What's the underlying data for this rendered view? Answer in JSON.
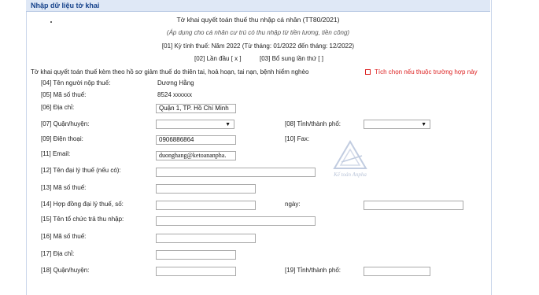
{
  "panel": {
    "title": "Nhập dữ liệu tờ khai"
  },
  "form": {
    "title": "Tờ khai quyết toán thuế thu nhập cá nhân (TT80/2021)",
    "subtitle": "(Áp dụng cho cá nhân cư trú có thu nhập từ tiền lương, tiền công)",
    "period": "[01] Kỳ tính thuế:   Năm 2022 (Từ tháng: 01/2022 đến tháng: 12/2022)",
    "first_time": "[02] Lần đầu [ x ]",
    "supplement": "[03] Bổ sung lần thứ   [ ]",
    "note": "Tờ khai quyết toán thuế kèm theo hồ sơ giảm thuế do thiên tai, hoả hoạn, tai nạn, bệnh hiểm nghèo",
    "checkbox_label": "Tích chọn nếu thuộc trường hợp này",
    "checkbox_checked": false
  },
  "fields": {
    "f04_label": "[04] Tên người nộp thuế:",
    "f04_value": "Dương Hằng",
    "f05_label": "[05] Mã số thuế:",
    "f05_value": "8524 xxxxxx",
    "f06_label": "[06] Địa chỉ:",
    "f06_value": "Quận 1, TP. Hồ Chí Minh",
    "f07_label": "[07] Quận/huyện:",
    "f08_label": "[08] Tỉnh/thành phố:",
    "f09_label": "[09] Điện thoại:",
    "f09_value": "0906886864",
    "f10_label": "[10] Fax:",
    "f11_label": "[11] Email:",
    "f11_value": "duonghang@ketoananpha.",
    "f12_label": "[12] Tên đại lý thuế (nếu có):",
    "f13_label": "[13] Mã số thuế:",
    "f14_label": "[14] Hợp đồng đại lý thuế, số:",
    "f14_date_label": "ngày:",
    "f15_label": "[15] Tên tổ chức trả thu nhập:",
    "f16_label": "[16] Mã số thuế:",
    "f17_label": "[17] Địa chỉ:",
    "f18_label": "[18] Quận/huyện:",
    "f19_label": "[19] Tỉnh/thành phố:"
  },
  "watermark": {
    "text": "Kế toán Anpha",
    "color": "#7f93b8"
  },
  "colors": {
    "header_bg": "#dfe8f6",
    "header_text": "#15428b",
    "note_red": "#d22222"
  }
}
